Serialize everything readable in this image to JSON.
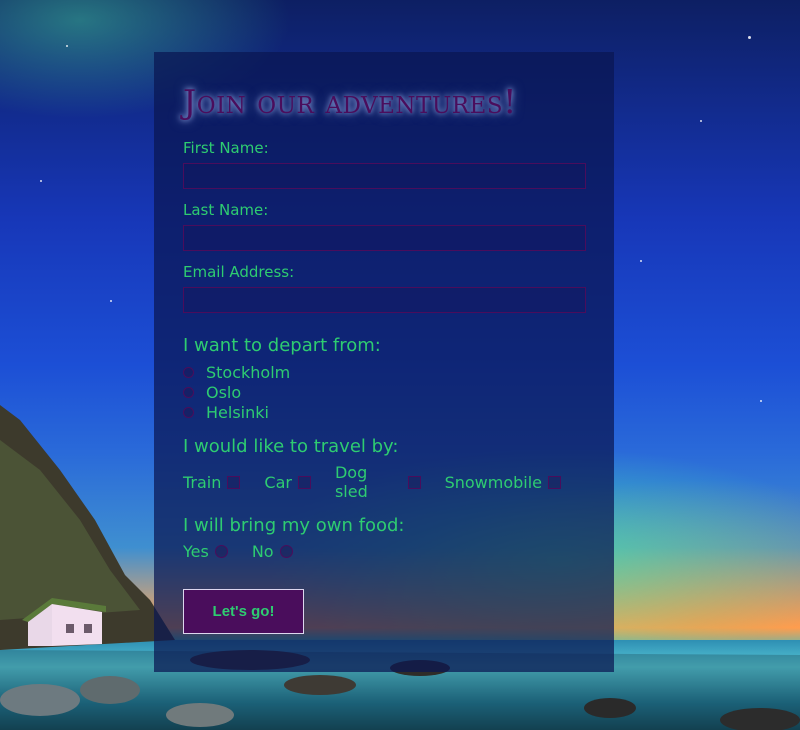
{
  "form": {
    "heading": "Join our adventures!",
    "first_name_label": "First Name:",
    "first_name_value": "",
    "last_name_label": "Last Name:",
    "last_name_value": "",
    "email_label": "Email Address:",
    "email_value": "",
    "depart": {
      "title": "I want to depart from:",
      "options": [
        "Stockholm",
        "Oslo",
        "Helsinki"
      ]
    },
    "travel": {
      "title": "I would like to travel by:",
      "options": [
        "Train",
        "Car",
        "Dog sled",
        "Snowmobile"
      ]
    },
    "food": {
      "title": "I will bring my own food:",
      "options": [
        "Yes",
        "No"
      ]
    },
    "submit_label": "Let's go!"
  },
  "colors": {
    "label_green": "#2ecc71",
    "accent_purple": "#4a0d5c",
    "panel_bg": "rgba(10,22,82,0.72)"
  }
}
